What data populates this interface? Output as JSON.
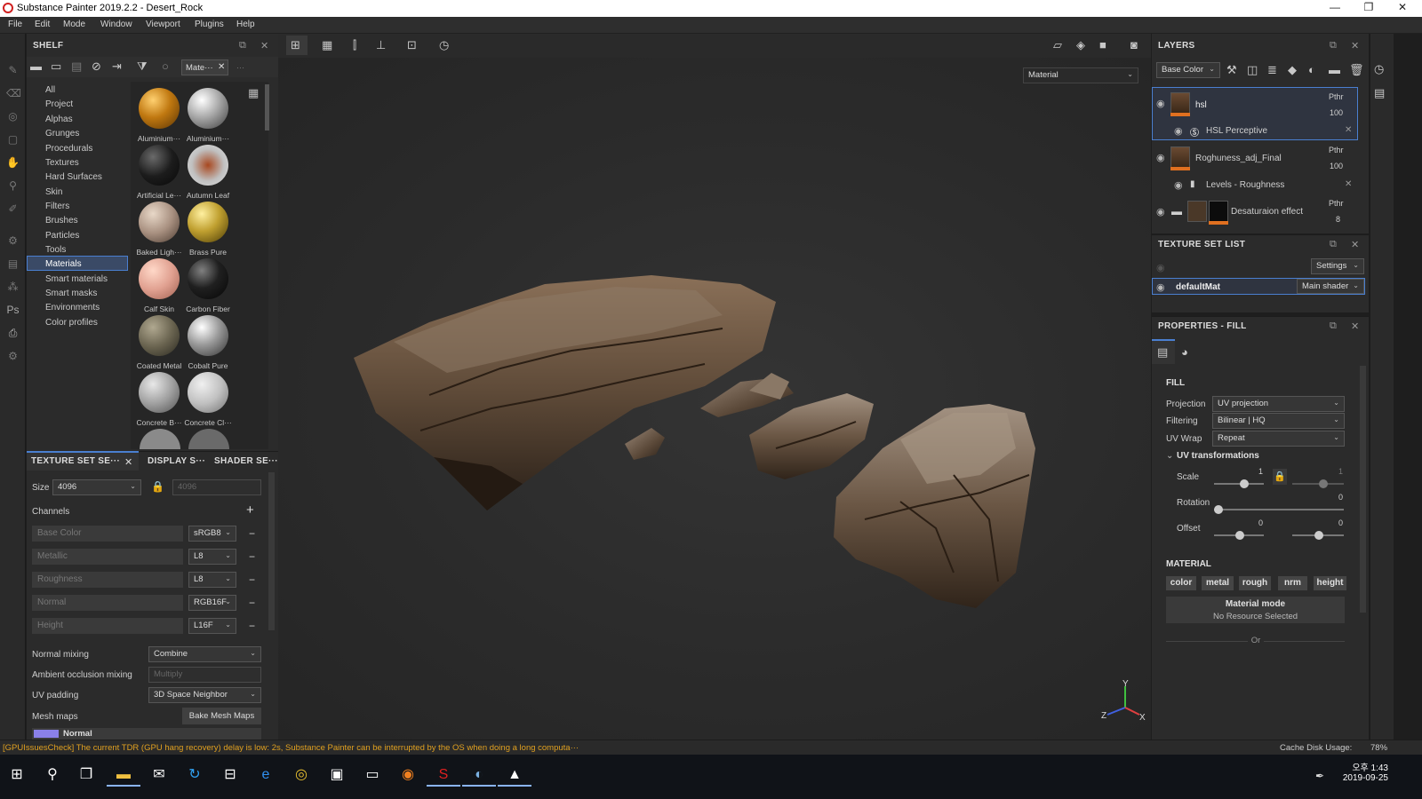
{
  "window": {
    "title": "Substance Painter 2019.2.2 - Desert_Rock"
  },
  "menu": [
    "File",
    "Edit",
    "Mode",
    "Window",
    "Viewport",
    "Plugins",
    "Help"
  ],
  "shelf": {
    "title": "SHELF",
    "search_tag": "Mate···",
    "categories": [
      "All",
      "Project",
      "Alphas",
      "Grunges",
      "Procedurals",
      "Textures",
      "Hard Surfaces",
      "Skin",
      "Filters",
      "Brushes",
      "Particles",
      "Tools",
      "Materials",
      "Smart materials",
      "Smart masks",
      "Environments",
      "Color profiles"
    ],
    "selected_category": "Materials",
    "materials": [
      "Aluminium···",
      "Aluminium···",
      "Artificial Le···",
      "Autumn Leaf",
      "Baked Ligh···",
      "Brass Pure",
      "Calf Skin",
      "Carbon Fiber",
      "Coated Metal",
      "Cobalt Pure",
      "Concrete B···",
      "Concrete Cl···"
    ]
  },
  "texset_settings": {
    "tabs": [
      "TEXTURE SET SE···",
      "DISPLAY S···",
      "SHADER SE···"
    ],
    "size_label": "Size",
    "size_value": "4096",
    "size_value2": "4096",
    "channels_label": "Channels",
    "channels": [
      {
        "name": "Base Color",
        "format": "sRGB8"
      },
      {
        "name": "Metallic",
        "format": "L8"
      },
      {
        "name": "Roughness",
        "format": "L8"
      },
      {
        "name": "Normal",
        "format": "RGB16F"
      },
      {
        "name": "Height",
        "format": "L16F"
      }
    ],
    "normal_mixing_label": "Normal mixing",
    "normal_mixing_value": "Combine",
    "ao_mixing_label": "Ambient occlusion mixing",
    "ao_mixing_value": "Multiply",
    "uv_padding_label": "UV padding",
    "uv_padding_value": "3D Space Neighbor",
    "mesh_maps_label": "Mesh maps",
    "bake_label": "Bake Mesh Maps",
    "mesh_map_first": "Normal"
  },
  "viewport": {
    "mode": "Material",
    "axes": {
      "y": "Y",
      "z": "Z",
      "x": "X"
    }
  },
  "layers": {
    "title": "LAYERS",
    "channel": "Base Color",
    "items": [
      {
        "name": "hsl",
        "blend": "Pthr",
        "opacity": "100",
        "effect": "HSL Perceptive"
      },
      {
        "name": "Roghuness_adj_Final",
        "blend": "Pthr",
        "opacity": "100",
        "effect": "Levels - Roughness"
      },
      {
        "name": "Desaturaion effect",
        "blend": "Pthr",
        "opacity": "8"
      }
    ]
  },
  "texture_set_list": {
    "title": "TEXTURE SET LIST",
    "settings": "Settings",
    "set_name": "defaultMat",
    "shader": "Main shader"
  },
  "properties": {
    "title": "PROPERTIES - FILL",
    "fill_header": "FILL",
    "projection_label": "Projection",
    "projection_value": "UV projection",
    "filtering_label": "Filtering",
    "filtering_value": "Bilinear | HQ",
    "uvwrap_label": "UV Wrap",
    "uvwrap_value": "Repeat",
    "uvt_label": "UV transformations",
    "scale_label": "Scale",
    "scale_value": "1",
    "scale_value2": "1",
    "rotation_label": "Rotation",
    "rotation_value": "0",
    "offset_label": "Offset",
    "offset_value": "0",
    "offset_value2": "0",
    "material_header": "MATERIAL",
    "material_buttons": [
      "color",
      "metal",
      "rough",
      "nrm",
      "height"
    ],
    "material_mode": "Material mode",
    "no_resource": "No Resource Selected",
    "or": "Or"
  },
  "status": {
    "message": "[GPUIssuesCheck] The current TDR (GPU hang recovery) delay is low: 2s, Substance Painter can be interrupted by the OS when doing a long computa···",
    "cache_label": "Cache Disk Usage:",
    "cache_value": "78%"
  },
  "taskbar": {
    "time": "오후 1:43",
    "date": "2019-09-25"
  },
  "colors": {
    "accent": "#e07020",
    "selection": "#4a7fd0",
    "status_warning": "#e0a020"
  }
}
